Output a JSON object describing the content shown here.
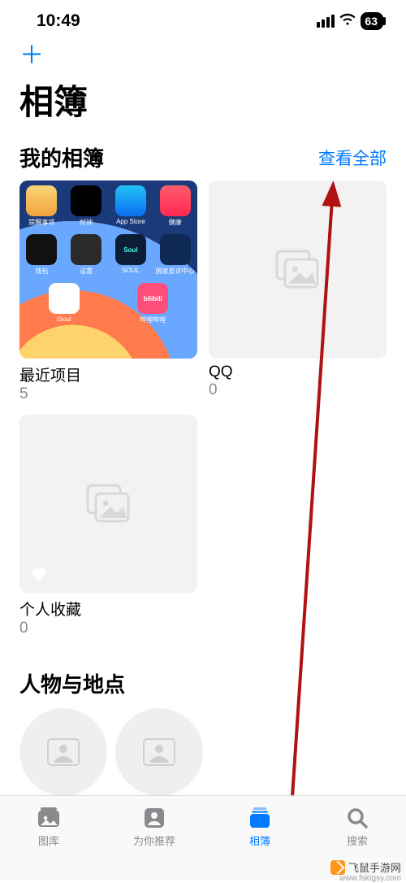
{
  "status": {
    "time": "10:49",
    "battery": "63"
  },
  "header": {
    "add_glyph": "＋",
    "title": "相簿"
  },
  "sections": {
    "my_albums": {
      "title": "我的相簿",
      "see_all": "查看全部",
      "items": [
        {
          "label": "最近项目",
          "count": "5"
        },
        {
          "label": "QQ",
          "count": "0"
        },
        {
          "label": "个人收藏",
          "count": "0"
        }
      ]
    },
    "people_places": {
      "title": "人物与地点"
    }
  },
  "home_apps": {
    "row1": [
      "提醒事项",
      "时钟",
      "App Store",
      "健康"
    ],
    "row2": [
      "钱包",
      "设置",
      "SOUL",
      "国家反诈中心"
    ],
    "row3": [
      "iSoul",
      "哔哩哔哩",
      "",
      ""
    ]
  },
  "tabs": [
    {
      "label": "图库"
    },
    {
      "label": "为你推荐"
    },
    {
      "label": "相簿"
    },
    {
      "label": "搜索"
    }
  ],
  "watermark": {
    "name": "飞鼠手游网",
    "url": "www.fsktgsy.com"
  },
  "colors": {
    "accent": "#007aff",
    "arrow": "#b01111"
  }
}
